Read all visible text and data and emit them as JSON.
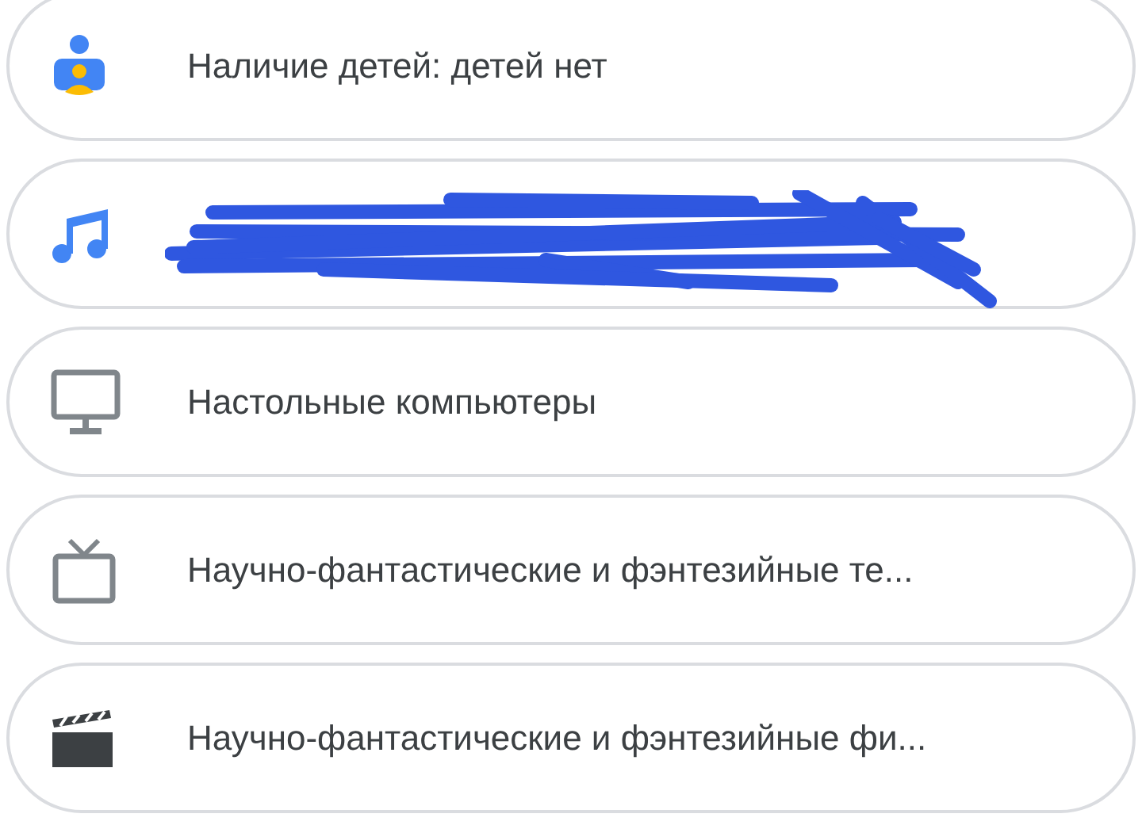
{
  "items": [
    {
      "kind": "text",
      "label": "Наличие детей: детей нет"
    },
    {
      "kind": "redacted"
    },
    {
      "kind": "text",
      "label": "Настольные компьютеры"
    },
    {
      "kind": "text",
      "label": "Научно-фантастические и фэнтезийные те..."
    },
    {
      "kind": "text",
      "label": "Научно-фантастические и фэнтезийные фи..."
    }
  ]
}
